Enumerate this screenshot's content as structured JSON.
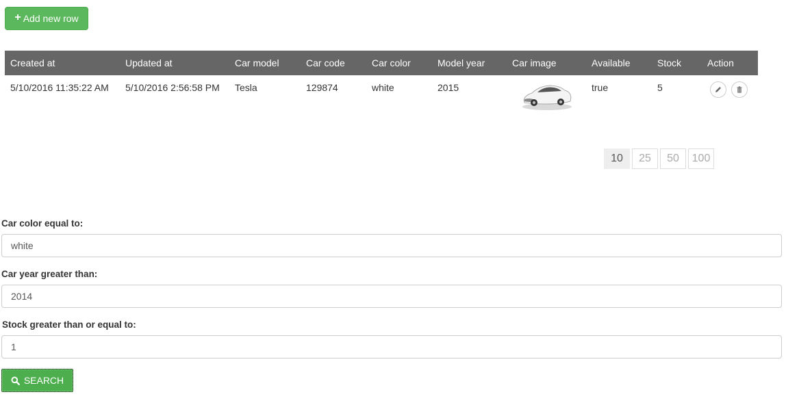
{
  "toolbar": {
    "add_label": "Add new row"
  },
  "grid": {
    "columns": [
      "Created at",
      "Updated at",
      "Car model",
      "Car code",
      "Car color",
      "Model year",
      "Car image",
      "Available",
      "Stock",
      "Action"
    ],
    "rows": [
      {
        "created_at": "5/10/2016 11:35:22 AM",
        "updated_at": "5/10/2016 2:56:58 PM",
        "car_model": "Tesla",
        "car_code": "129874",
        "car_color": "white",
        "model_year": "2015",
        "available": "true",
        "stock": "5"
      }
    ]
  },
  "pager": {
    "sizes": [
      "10",
      "25",
      "50",
      "100"
    ],
    "selected": "10"
  },
  "filters": {
    "color_label": "Car color equal to:",
    "color_value": "white",
    "year_label": "Car year greater than:",
    "year_value": "2014",
    "stock_label": "Stock greater than or equal to:",
    "stock_value": "1",
    "search_label": "SEARCH"
  },
  "icons": {
    "add": "plus-icon",
    "edit": "pencil-icon",
    "delete": "trash-icon",
    "search": "search-icon"
  },
  "colors": {
    "success": "#5cb85c",
    "header": "#666666"
  }
}
